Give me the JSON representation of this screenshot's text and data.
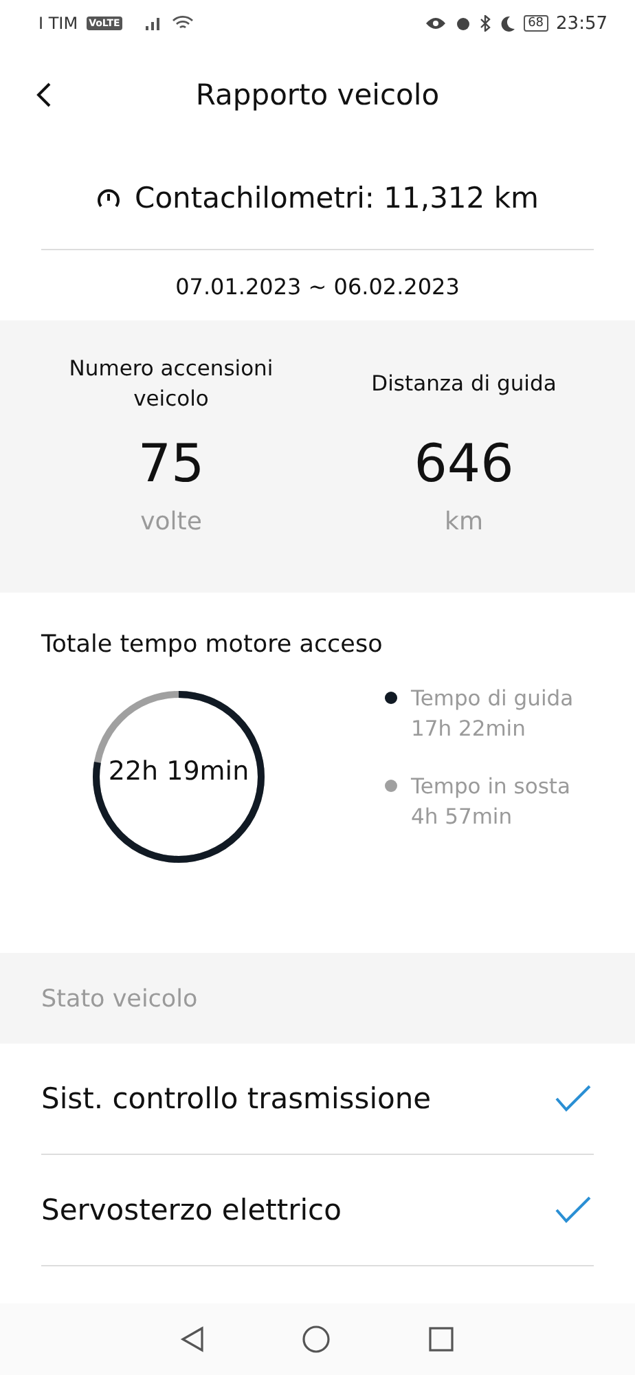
{
  "status_bar": {
    "carrier": "I TIM",
    "network_badge": "VoLTE",
    "battery": "68",
    "time": "23:57"
  },
  "header": {
    "title": "Rapporto veicolo"
  },
  "odometer": "Contachilometri: 11,312 km",
  "period": "07.01.2023 ~ 06.02.2023",
  "stats": [
    {
      "label": "Numero accensioni veicolo",
      "value": "75",
      "unit": "volte"
    },
    {
      "label": "Distanza di guida",
      "value": "646",
      "unit": "km"
    }
  ],
  "engine_time": {
    "title": "Totale tempo motore acceso",
    "total": "22h 19min",
    "level": 0.778,
    "legend": [
      {
        "label": "Tempo di guida",
        "value": "17h 22min",
        "color": "#111a24"
      },
      {
        "label": "Tempo in sosta",
        "value": "4h 57min",
        "color": "#a0a0a0"
      }
    ]
  },
  "vehicle_status": {
    "title": "Stato veicolo",
    "items": [
      {
        "label": "Sist. controllo trasmissione",
        "checked": true
      },
      {
        "label": "Servosterzo elettrico",
        "checked": true
      }
    ]
  }
}
